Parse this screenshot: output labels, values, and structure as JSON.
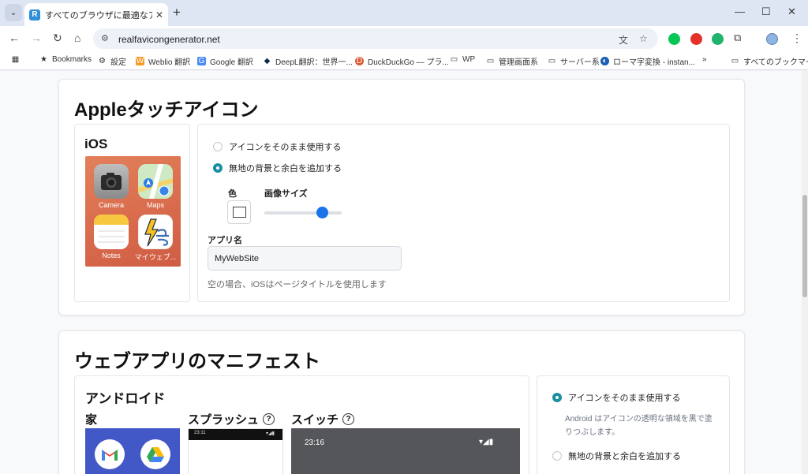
{
  "browser": {
    "tab_title": "すべてのブラウザに最適なアイコンを...",
    "favicon_letter": "R",
    "url": "realfavicongenerator.net",
    "bookmarks": [
      {
        "label": "Bookmarks",
        "icon": "star-icon"
      },
      {
        "label": "設定",
        "icon": "gear-icon"
      },
      {
        "label": "Weblio 翻訳",
        "icon": "weblio-icon"
      },
      {
        "label": "Google 翻訳",
        "icon": "google-translate-icon"
      },
      {
        "label": "DeepL翻訳：世界一...",
        "icon": "deepl-icon"
      },
      {
        "label": "DuckDuckGo — プラ...",
        "icon": "duckduckgo-icon"
      },
      {
        "label": "WP",
        "icon": "folder-icon"
      },
      {
        "label": "管理画面系",
        "icon": "folder-icon"
      },
      {
        "label": "サーバー系",
        "icon": "folder-icon"
      },
      {
        "label": "ローマ字変換 - instan...",
        "icon": "web-icon"
      }
    ],
    "all_bookmarks": "すべてのブックマーク"
  },
  "apple": {
    "title": "Appleタッチアイコン",
    "ios_title": "iOS",
    "apps": [
      "Camera",
      "Maps",
      "Notes",
      "マイウェブ..."
    ],
    "option_keep": "アイコンをそのまま使用する",
    "option_add_bg": "無地の背景と余白を追加する",
    "color_label": "色",
    "size_label": "画像サイズ",
    "slider_value": 0.75,
    "app_name_label": "アプリ名",
    "app_name_value": "MyWebSite",
    "app_name_help": "空の場合、iOSはページタイトルを使用します"
  },
  "manifest": {
    "title": "ウェブアプリのマニフェスト",
    "android_title": "アンドロイド",
    "home_label": "家",
    "splash_label": "スプラッシュ",
    "switch_label": "スイッチ",
    "splash_time": "23:11",
    "switch_time": "23:16",
    "option_keep": "アイコンをそのまま使用する",
    "option_keep_note": "Android はアイコンの透明な領域を黒で塗りつぶします。",
    "option_add_bg": "無地の背景と余白を追加する"
  },
  "colors": {
    "accent": "#1b8fa2",
    "slider": "#1a73e8"
  }
}
